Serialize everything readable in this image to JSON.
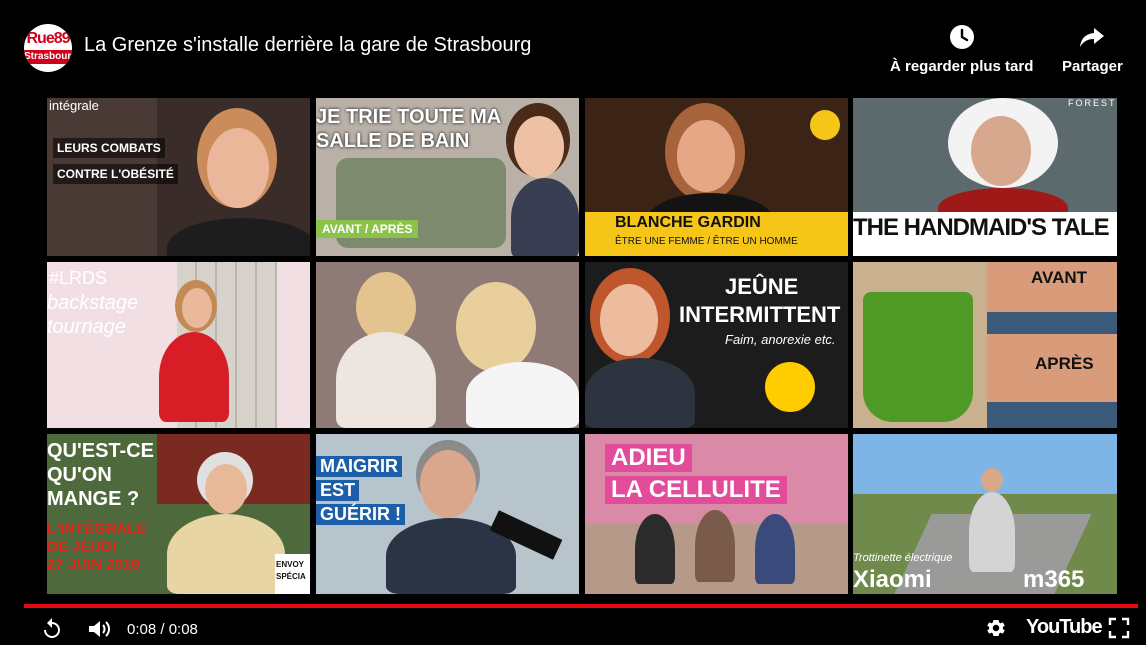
{
  "header": {
    "logo_top": "Rue89",
    "logo_bottom": "Strasbourg",
    "title": "La Grenze s'installe derrière la gare de Strasbourg",
    "watch_later_label": "À regarder plus tard",
    "share_label": "Partager"
  },
  "tiles": [
    {
      "lines": [
        "intégrale",
        "LEURS COMBATS",
        "CONTRE L'OBÉSITÉ"
      ]
    },
    {
      "lines": [
        "JE TRIE TOUTE MA",
        "SALLE DE BAIN",
        "AVANT / APRÈS"
      ]
    },
    {
      "lines": [
        "BLANCHE GARDIN",
        "ÊTRE UNE FEMME / ÊTRE UN HOMME"
      ]
    },
    {
      "lines": [
        "FORESTIV",
        "THE HANDMAID'S TALE"
      ]
    },
    {
      "lines": [
        "#LRDS",
        "backstage",
        "tournage"
      ]
    },
    {
      "lines": []
    },
    {
      "lines": [
        "JEÛNE",
        "INTERMITTENT",
        "Faim, anorexie etc."
      ]
    },
    {
      "lines": [
        "AVANT",
        "APRÈS"
      ]
    },
    {
      "lines": [
        "QU'EST-CE",
        "QU'ON",
        "MANGE ?",
        "L'INTÉGRALE",
        "DE JEUDI",
        "27 JUIN 2019",
        "ENVOY",
        "SPÉCIA"
      ]
    },
    {
      "lines": [
        "MAIGRIR",
        "EST",
        "GUÉRIR !"
      ]
    },
    {
      "lines": [
        "ADIEU",
        "LA CELLULITE"
      ]
    },
    {
      "lines": [
        "Trottinette électrique",
        "Xiaomi",
        "m365"
      ]
    }
  ],
  "controls": {
    "time": "0:08 / 0:08",
    "brand": "YouTube",
    "progress": 1.0
  },
  "colors": {
    "accent": "#e50914",
    "brand_red": "#d0021b"
  }
}
